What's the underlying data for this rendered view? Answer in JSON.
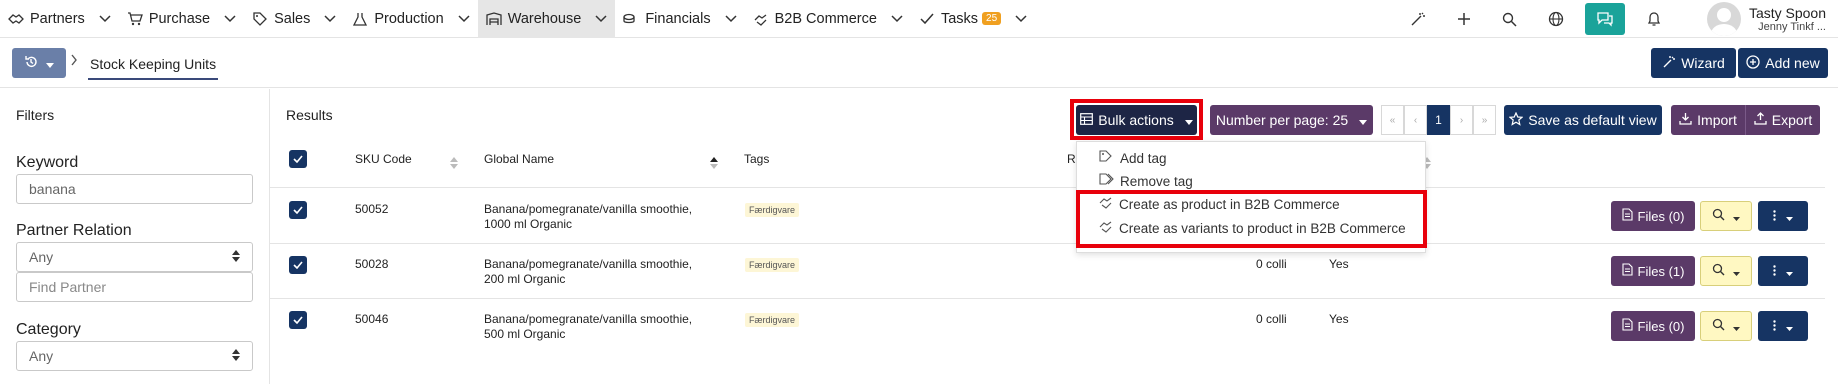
{
  "nav": {
    "items": [
      {
        "label": "Partners",
        "icon": "partners-icon"
      },
      {
        "label": "Purchase",
        "icon": "cart-icon"
      },
      {
        "label": "Sales",
        "icon": "tag-icon"
      },
      {
        "label": "Production",
        "icon": "flask-icon"
      },
      {
        "label": "Warehouse",
        "icon": "warehouse-icon"
      },
      {
        "label": "Financials",
        "icon": "coins-icon"
      },
      {
        "label": "B2B Commerce",
        "icon": "handshake-icon"
      },
      {
        "label": "Tasks",
        "icon": "check-icon",
        "badge": "25"
      }
    ],
    "user": {
      "name": "Tasty Spoon",
      "sub": "Jenny Tinkf ..."
    }
  },
  "subbar": {
    "breadcrumb": "Stock Keeping Units",
    "wizard_label": "Wizard",
    "add_new_label": "Add new"
  },
  "filters": {
    "title": "Filters",
    "keyword_label": "Keyword",
    "keyword_value": "banana",
    "partner_relation_label": "Partner Relation",
    "partner_relation_value": "Any",
    "find_partner_placeholder": "Find Partner",
    "category_label": "Category",
    "category_value": "Any"
  },
  "results": {
    "title": "Results",
    "bulk_actions_label": "Bulk actions",
    "per_page_label": "Number per page: 25",
    "pager": {
      "first": "«",
      "prev": "‹",
      "current": "1",
      "next": "›",
      "last": "»"
    },
    "save_default_label": "Save as default view",
    "import_label": "Import",
    "export_label": "Export",
    "columns": {
      "sku": "SKU Code",
      "name": "Global Name",
      "tags": "Tags",
      "r": "R"
    },
    "rows": [
      {
        "sku": "50052",
        "name1": "Banana/pomegranate/vanilla smoothie,",
        "name2": "1000 ml Organic",
        "tag": "Færdigvare",
        "stock": "",
        "flag": "",
        "files": "Files (0)"
      },
      {
        "sku": "50028",
        "name1": "Banana/pomegranate/vanilla smoothie,",
        "name2": "200 ml Organic",
        "tag": "Færdigvare",
        "stock": "0 colli",
        "flag": "Yes",
        "files": "Files (1)"
      },
      {
        "sku": "50046",
        "name1": "Banana/pomegranate/vanilla smoothie,",
        "name2": "500 ml Organic",
        "tag": "Færdigvare",
        "stock": "0 colli",
        "flag": "Yes",
        "files": "Files (0)"
      }
    ],
    "dropdown": {
      "add_tag": "Add tag",
      "remove_tag": "Remove tag",
      "create_product": "Create as product in B2B Commerce",
      "create_variants": "Create as variants to product in B2B Commerce"
    }
  },
  "colors": {
    "navy": "#163463",
    "purple": "#5b3a68",
    "teal": "#1aa39a",
    "highlight_red": "#e8000b",
    "tag_bg": "#fdf6d6"
  }
}
